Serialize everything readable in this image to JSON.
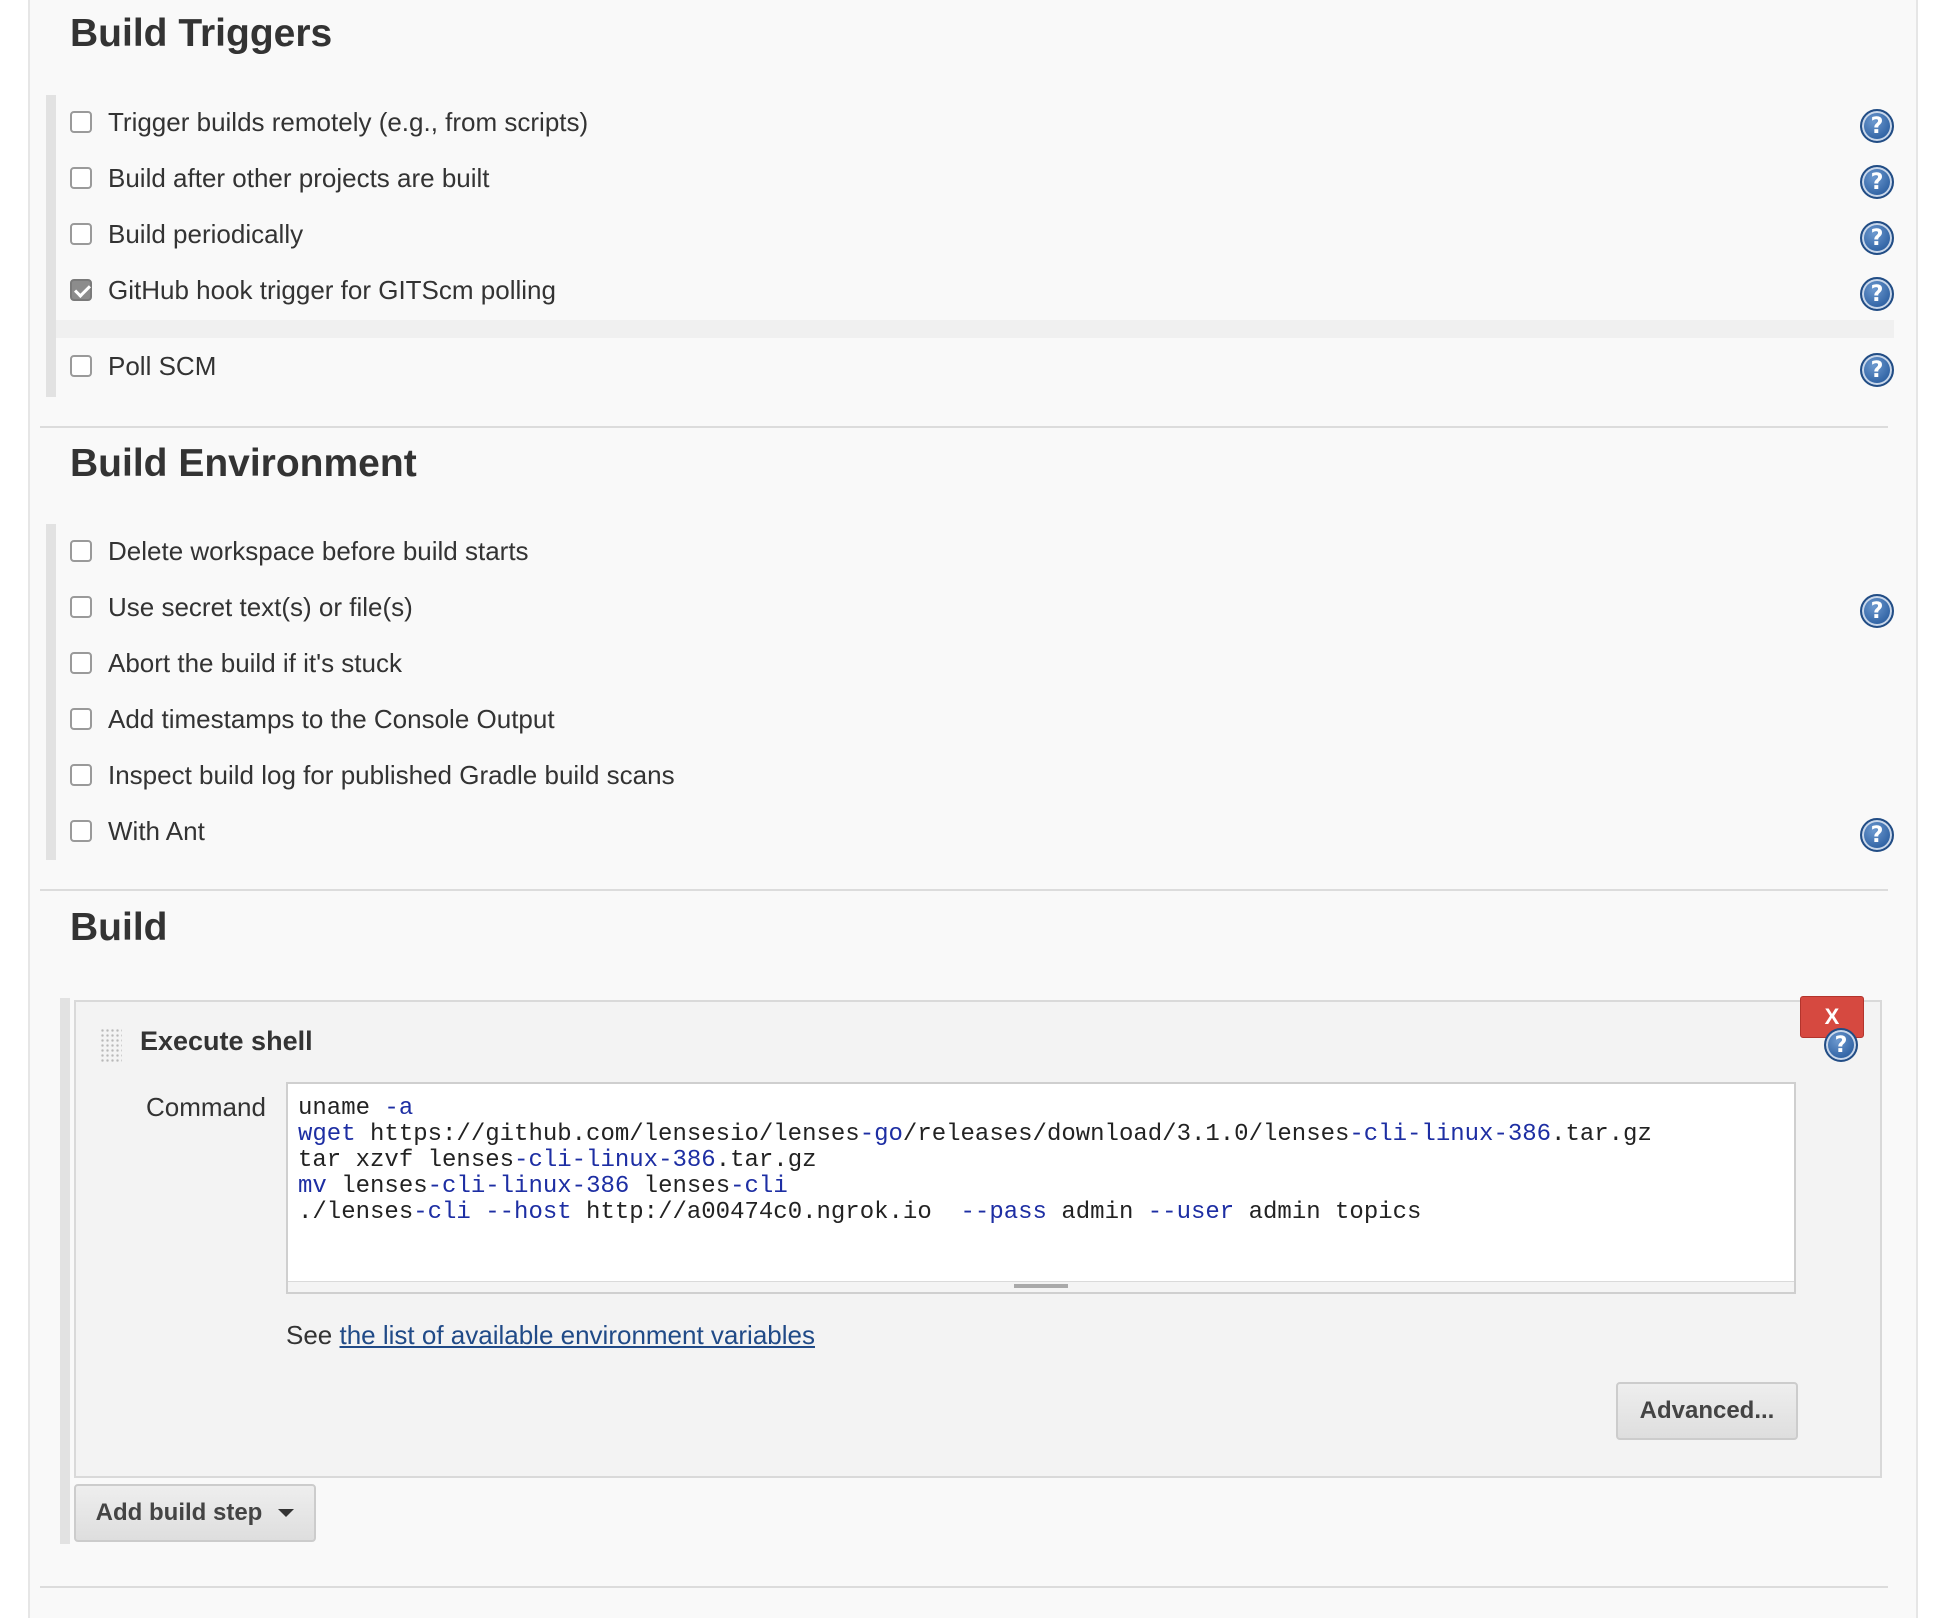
{
  "build_triggers": {
    "title": "Build Triggers",
    "options": [
      {
        "label": "Trigger builds remotely (e.g., from scripts)",
        "checked": false,
        "help": true
      },
      {
        "label": "Build after other projects are built",
        "checked": false,
        "help": true
      },
      {
        "label": "Build periodically",
        "checked": false,
        "help": true
      },
      {
        "label": "GitHub hook trigger for GITScm polling",
        "checked": true,
        "help": true
      },
      {
        "label": "Poll SCM",
        "checked": false,
        "help": true
      }
    ]
  },
  "build_environment": {
    "title": "Build Environment",
    "options": [
      {
        "label": "Delete workspace before build starts",
        "checked": false,
        "help": false
      },
      {
        "label": "Use secret text(s) or file(s)",
        "checked": false,
        "help": true
      },
      {
        "label": "Abort the build if it's stuck",
        "checked": false,
        "help": false
      },
      {
        "label": "Add timestamps to the Console Output",
        "checked": false,
        "help": false
      },
      {
        "label": "Inspect build log for published Gradle build scans",
        "checked": false,
        "help": false
      },
      {
        "label": "With Ant",
        "checked": false,
        "help": true
      }
    ]
  },
  "build": {
    "title": "Build",
    "step": {
      "title": "Execute shell",
      "delete_label": "X",
      "command_label": "Command",
      "command_lines": [
        "uname -a",
        "wget https://github.com/lensesio/lenses-go/releases/download/3.1.0/lenses-cli-linux-386.tar.gz",
        "tar xzvf lenses-cli-linux-386.tar.gz",
        "mv lenses-cli-linux-386 lenses-cli",
        "./lenses-cli --host http://a00474c0.ngrok.io  --pass admin --user admin topics"
      ],
      "env_note_prefix": "See ",
      "env_link": "the list of available environment variables",
      "advanced_label": "Advanced..."
    },
    "add_step_label": "Add build step"
  },
  "help_glyph": "?",
  "colors": {
    "help_blue": "#2f62a3",
    "delete_red": "#d64940",
    "keyword_blue": "#1d2ea3",
    "link_blue": "#204a87"
  }
}
